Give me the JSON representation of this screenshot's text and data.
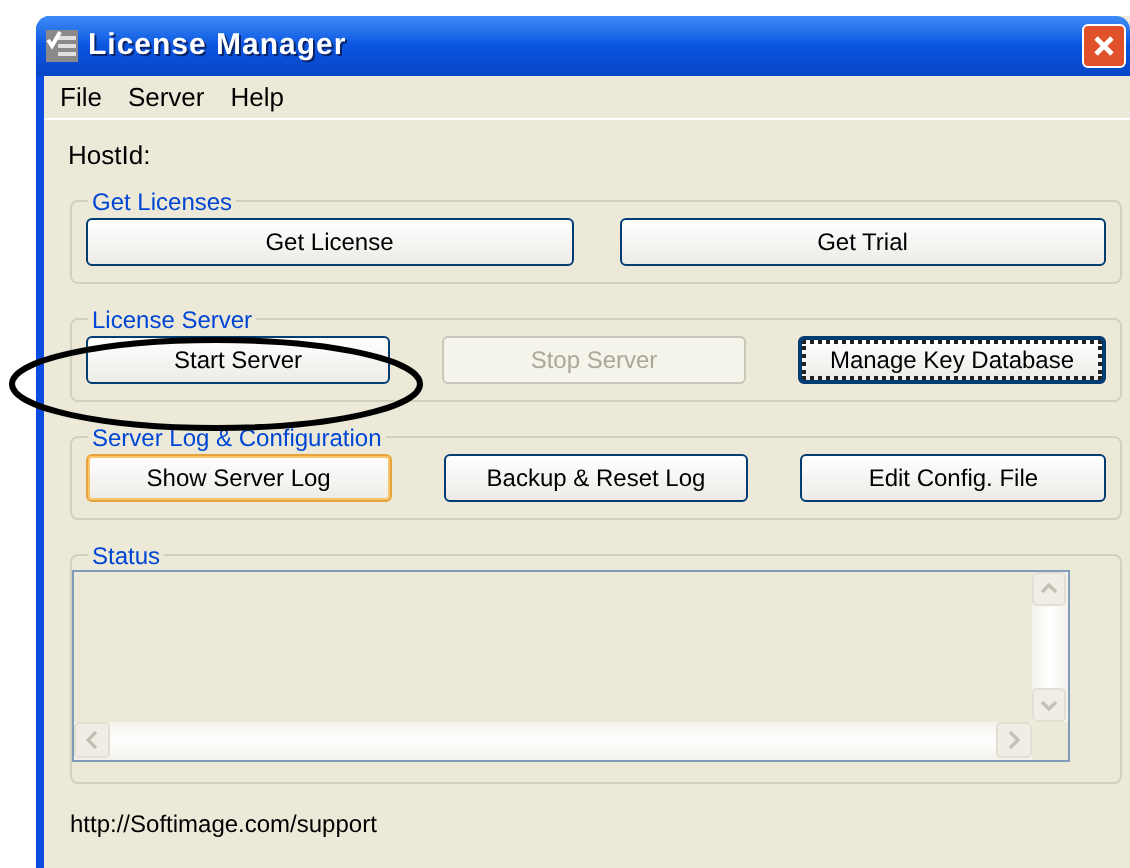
{
  "window": {
    "title": "License Manager"
  },
  "menu": [
    {
      "label": "File"
    },
    {
      "label": "Server"
    },
    {
      "label": "Help"
    }
  ],
  "host_id": {
    "label": "HostId:"
  },
  "groups": [
    {
      "title": "Get Licenses",
      "buttons": [
        {
          "label": "Get License",
          "disabled": false,
          "focused": false,
          "hot": false
        },
        {
          "label": "Get Trial",
          "disabled": false,
          "focused": false,
          "hot": false
        }
      ]
    },
    {
      "title": "License Server",
      "buttons": [
        {
          "label": "Start Server",
          "disabled": false,
          "focused": false,
          "hot": false
        },
        {
          "label": "Stop Server",
          "disabled": true,
          "focused": false,
          "hot": false
        },
        {
          "label": "Manage Key Database",
          "disabled": false,
          "focused": true,
          "hot": false
        }
      ]
    },
    {
      "title": "Server Log & Configuration",
      "buttons": [
        {
          "label": "Show Server Log",
          "disabled": false,
          "focused": false,
          "hot": true
        },
        {
          "label": "Backup & Reset Log",
          "disabled": false,
          "focused": false,
          "hot": false
        },
        {
          "label": "Edit Config. File",
          "disabled": false,
          "focused": false,
          "hot": false
        }
      ]
    }
  ],
  "status": {
    "title": "Status"
  },
  "footer": {
    "text": "http://Softimage.com/support"
  }
}
